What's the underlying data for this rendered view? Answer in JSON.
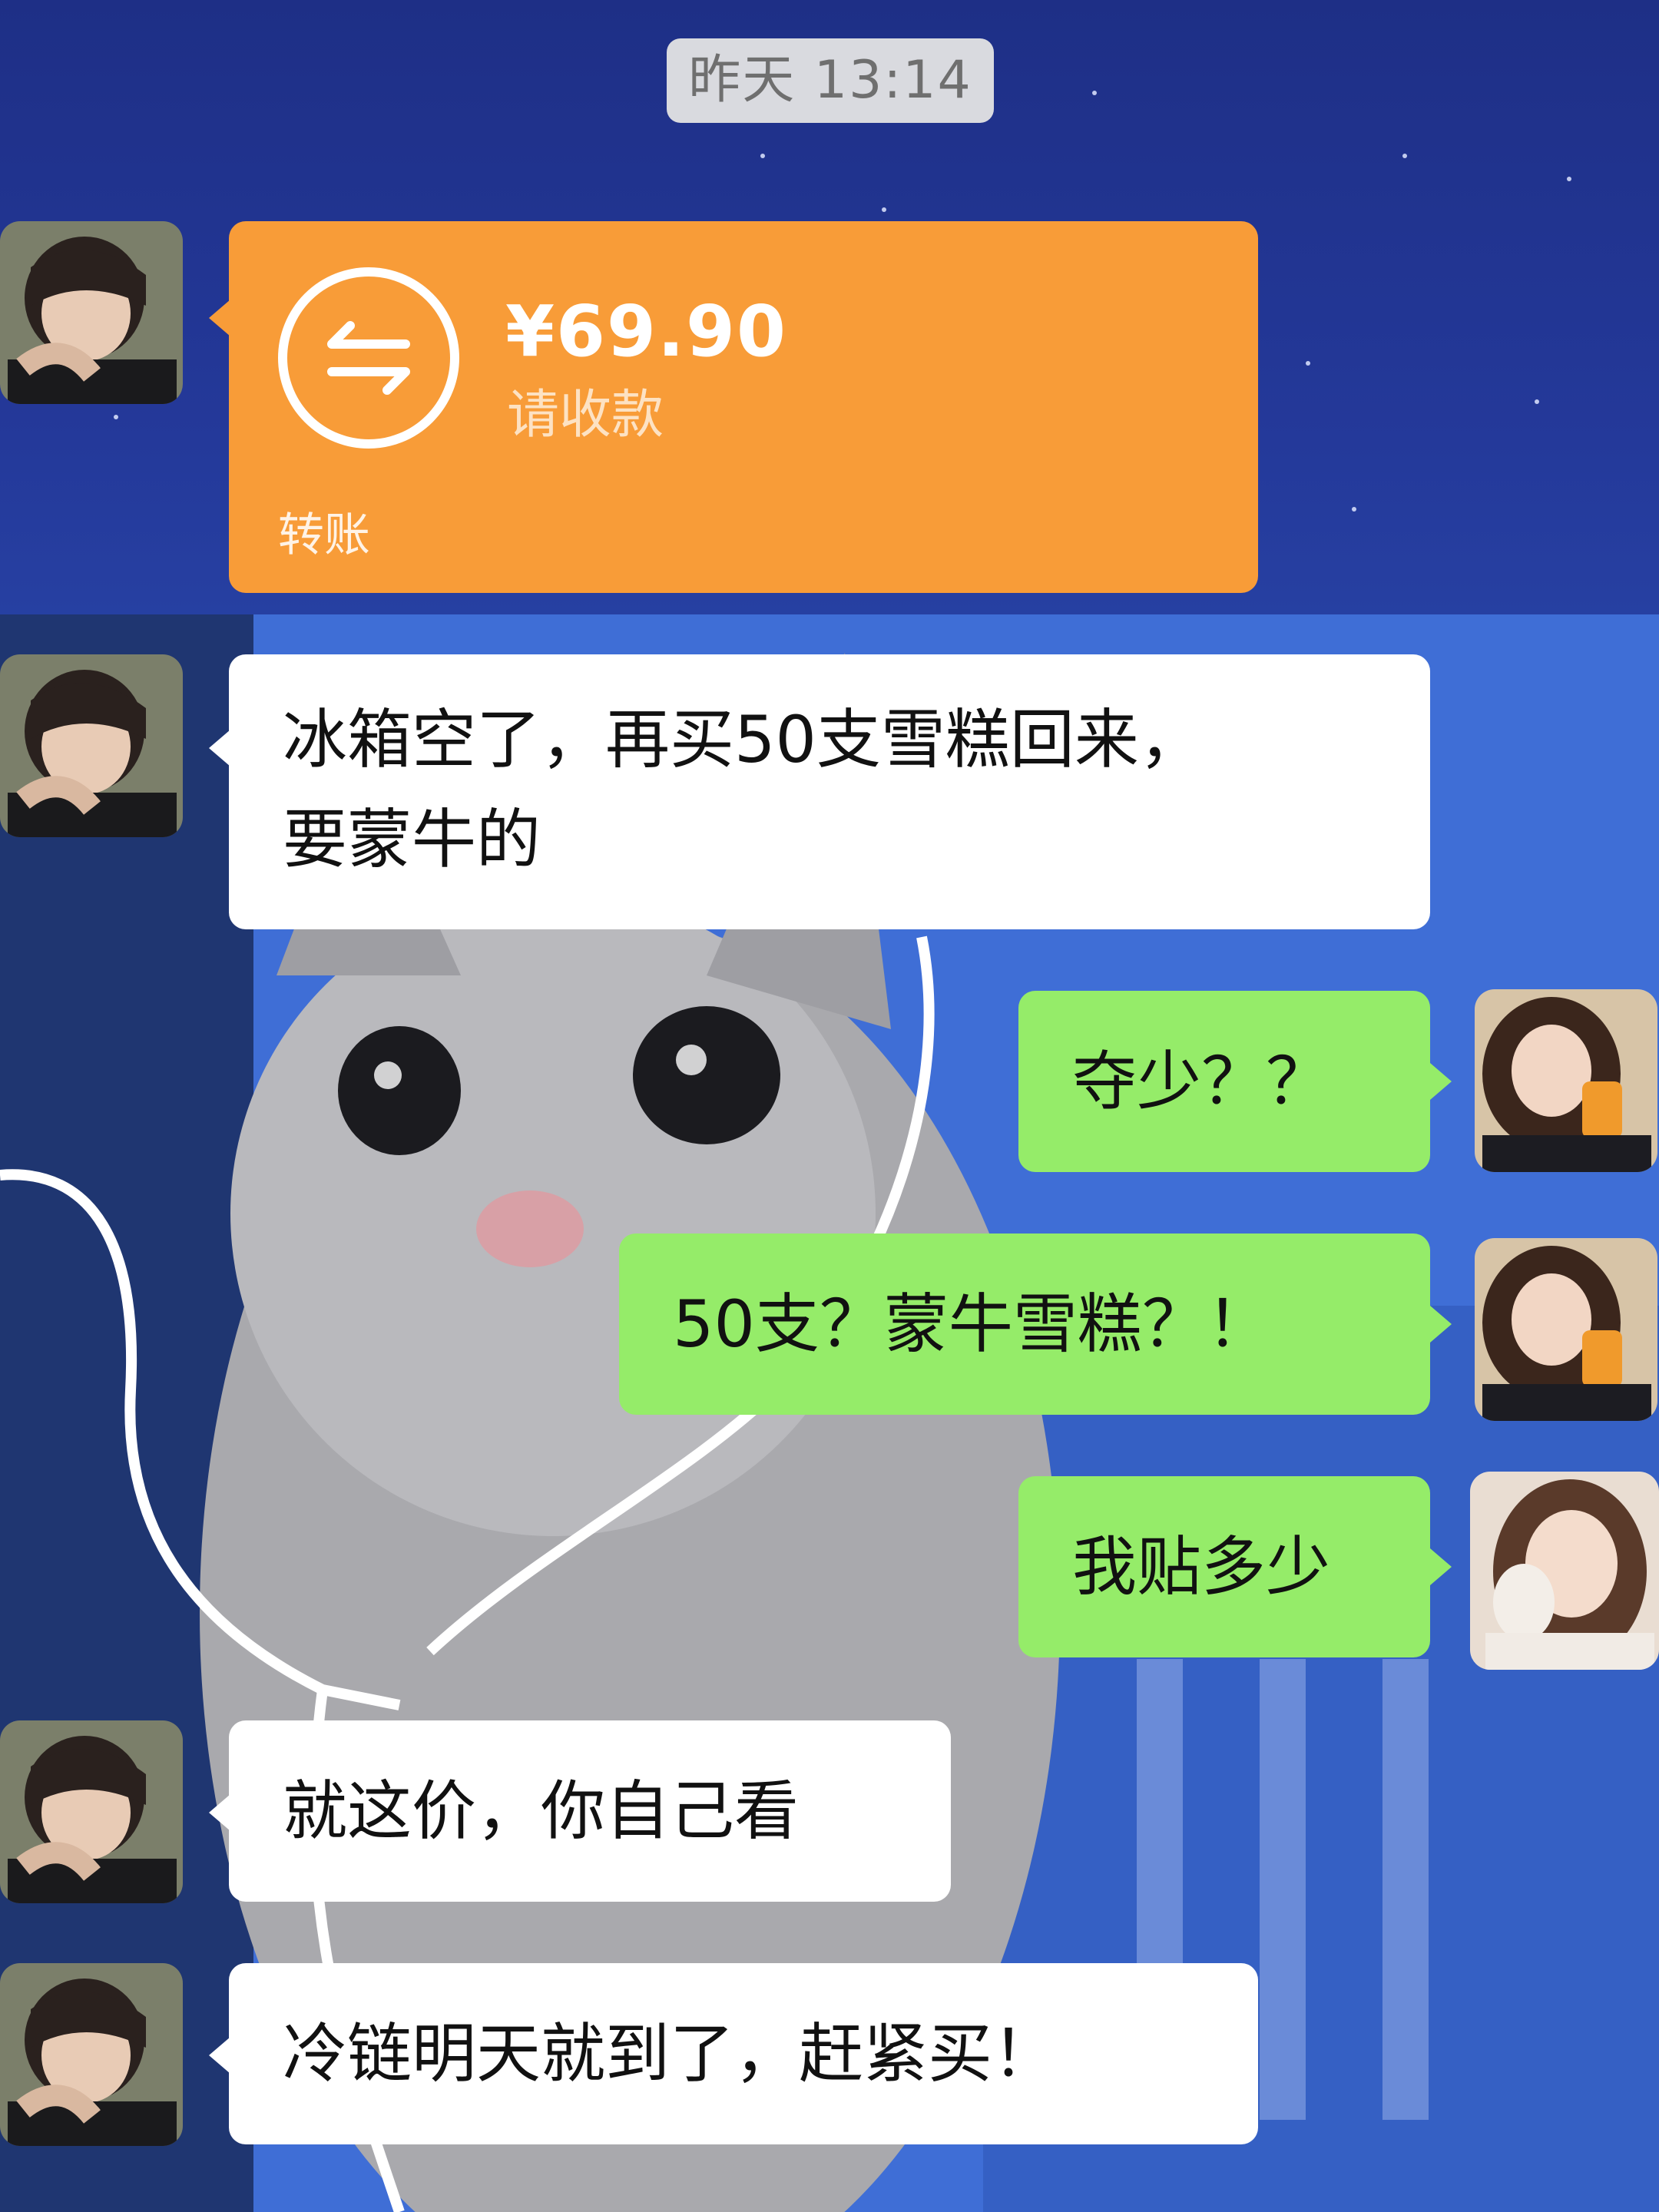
{
  "timestamp": "昨天 13:14",
  "transfer": {
    "amount": "¥69.90",
    "subtitle": "请收款",
    "footer": "转账",
    "color": "#f89c38",
    "icon": "transfer-arrows-icon"
  },
  "messages": [
    {
      "sender": "contact",
      "text_line1": "冰箱空了，再买50支雪糕回来，",
      "text_line2": "要蒙牛的"
    },
    {
      "sender": "me",
      "text": "夺少？？"
    },
    {
      "sender": "me",
      "text": "50支？蒙牛雪糕？！"
    },
    {
      "sender": "me",
      "text": "我贴多少"
    },
    {
      "sender": "contact",
      "text": "就这价，你自己看"
    },
    {
      "sender": "contact",
      "text": "冷链明天就到了，赶紧买！"
    }
  ],
  "colors": {
    "bubble_green": "#95ec69",
    "bubble_white": "#ffffff",
    "timestamp_bg": "#d9dadf"
  }
}
